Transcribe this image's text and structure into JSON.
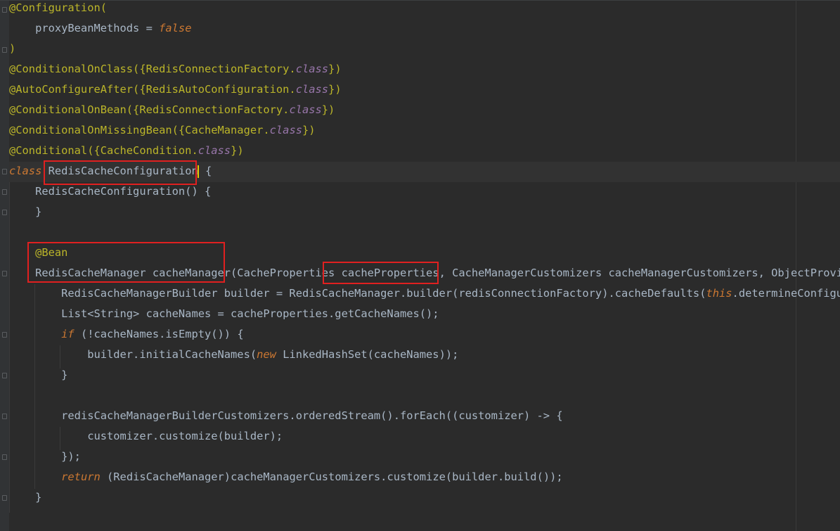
{
  "editor": {
    "lines": [
      [
        "@Configuration("
      ],
      [
        "    proxyBeanMethods = ",
        "false"
      ],
      [
        ")"
      ],
      [
        "@ConditionalOnClass({RedisConnectionFactory.",
        "class",
        "})"
      ],
      [
        "@AutoConfigureAfter({RedisAutoConfiguration.",
        "class",
        "})"
      ],
      [
        "@ConditionalOnBean({RedisConnectionFactory.",
        "class",
        "})"
      ],
      [
        "@ConditionalOnMissingBean({CacheManager.",
        "class",
        "})"
      ],
      [
        "@Conditional({CacheCondition.",
        "class",
        "})"
      ],
      [
        "class",
        " ",
        "RedisCacheConfiguration",
        " {"
      ],
      [
        "    RedisCacheConfiguration() {"
      ],
      [
        "    }"
      ],
      [
        ""
      ],
      [
        "    @Bean"
      ],
      [
        "    RedisCacheManager cacheManager(CacheProperties ",
        "cacheProperties,",
        " CacheManagerCustomizers cacheManagerCustomizers, ObjectProvider<"
      ],
      [
        "        RedisCacheManagerBuilder builder = RedisCacheManager.builder(redisConnectionFactory).cacheDefaults(",
        "this",
        ".determineConfigurati"
      ],
      [
        "        List<String> cacheNames = cacheProperties.getCacheNames();"
      ],
      [
        "        ",
        "if",
        " (!cacheNames.isEmpty()) {"
      ],
      [
        "            builder.initialCacheNames(",
        "new",
        " LinkedHashSet(cacheNames));"
      ],
      [
        "        }"
      ],
      [
        ""
      ],
      [
        "        redisCacheManagerBuilderCustomizers.orderedStream().forEach((customizer) -> {"
      ],
      [
        "            customizer.customize(builder);"
      ],
      [
        "        });"
      ],
      [
        "        ",
        "return",
        " (RedisCacheManager)cacheManagerCustomizers.customize(builder.build());"
      ],
      [
        "    }"
      ]
    ]
  },
  "colors": {
    "background": "#2b2b2b",
    "text": "#a9b7c6",
    "annotation": "#bbb529",
    "keyword": "#cc7832",
    "class_keyword": "#9876aa",
    "highlight_box": "#e02020",
    "caret": "#e6c800"
  }
}
